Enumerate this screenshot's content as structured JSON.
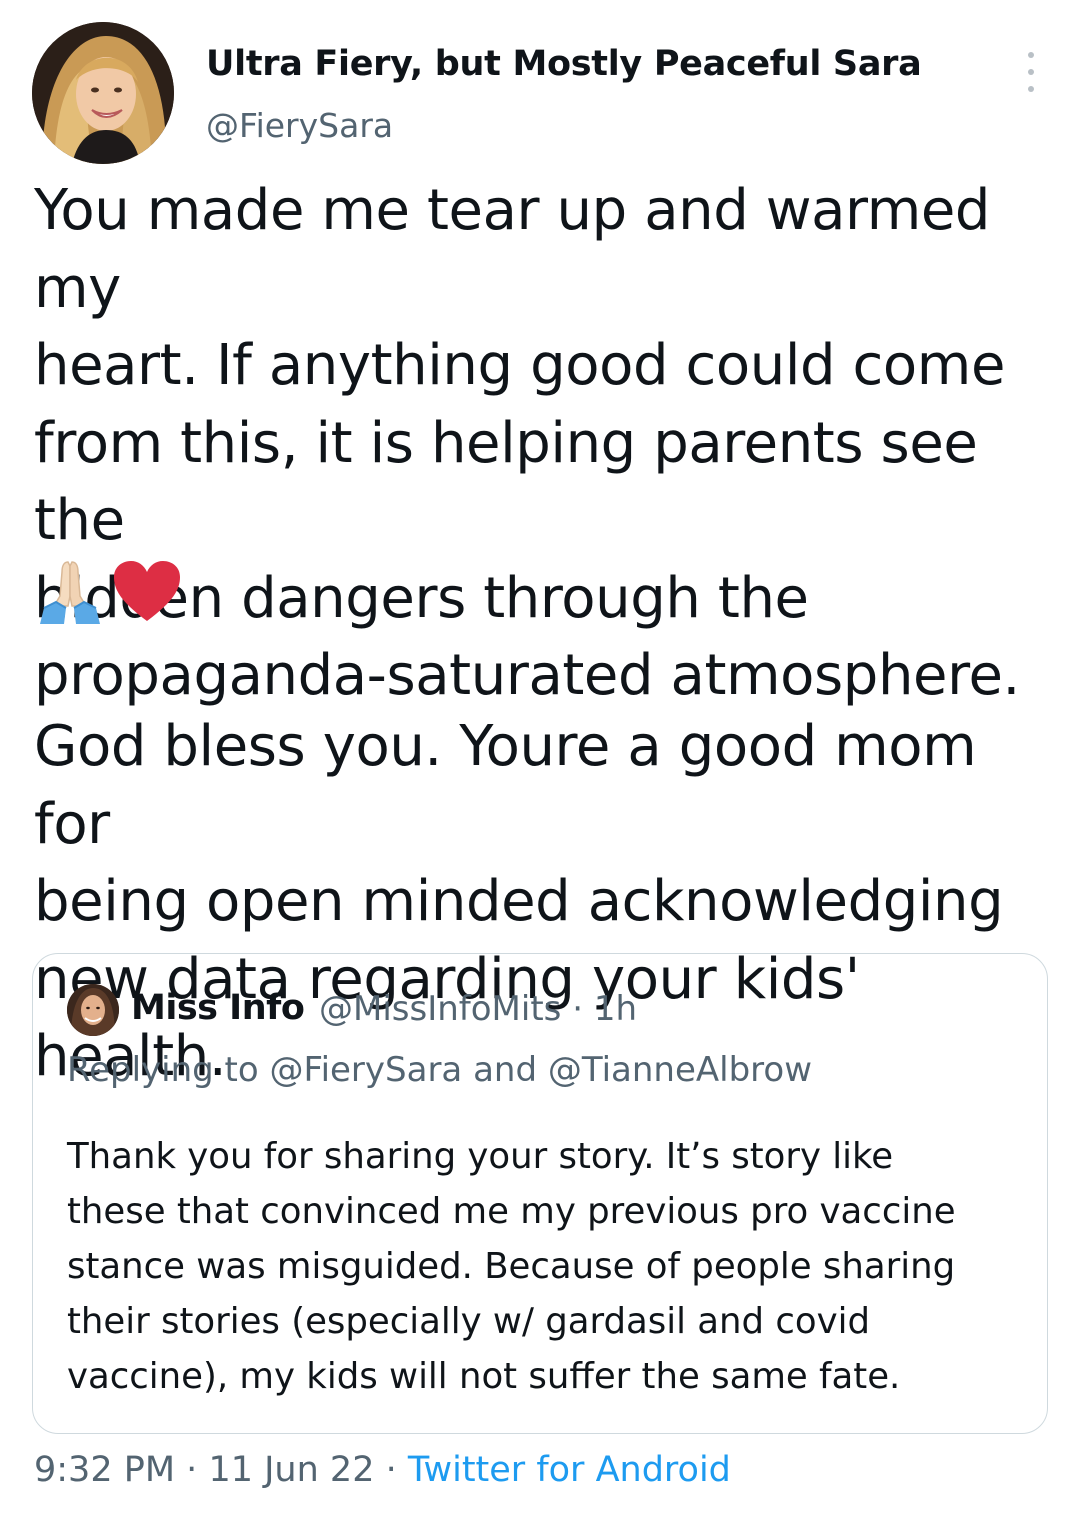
{
  "author": {
    "display_name": "Ultra Fiery, but Mostly Peaceful Sara",
    "handle": "@FierySara",
    "avatar_icon": "profile-photo"
  },
  "tweet": {
    "text_1": "You made me tear up and warmed my\nheart. If anything good could come\nfrom this, it is helping parents see the\nhidden dangers through the\npropaganda-saturated atmosphere.",
    "emojis": [
      "folded-hands-emoji",
      "red-heart-emoji"
    ],
    "text_2": "God bless you. Youre a good mom for\nbeing open minded acknowledging\nnew data regarding your kids' health."
  },
  "quoted_tweet": {
    "display_name": "Miss Info",
    "handle": "@MissInfoMits",
    "separator": "·",
    "time_ago": "1h",
    "replying_to": "Replying to @FierySara and @TianneAlbrow",
    "text": "Thank you for sharing your story. It’s story like\nthese that convinced me my previous pro vaccine\nstance was misguided. Because of people sharing\ntheir stories (especially w/ gardasil and covid\nvaccine), my kids will not suffer the same fate."
  },
  "footer": {
    "time": "9:32 PM",
    "date": "11 Jun 22",
    "source": "Twitter for Android"
  },
  "colors": {
    "text_primary": "#0f1419",
    "text_secondary": "#536471",
    "link": "#1d9bf0",
    "border": "#cfd9de"
  }
}
